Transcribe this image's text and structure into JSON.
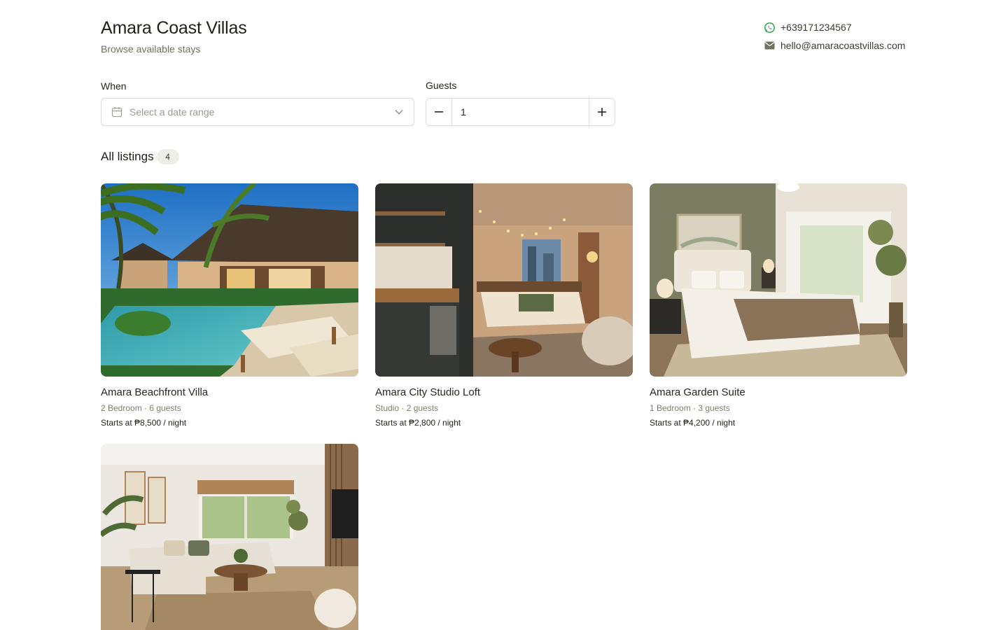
{
  "header": {
    "title": "Amara Coast Villas",
    "subtitle": "Browse available stays"
  },
  "contact": {
    "phone": "+639171234567",
    "phone_icon": "whatsapp-icon",
    "email": "hello@amaracoastvillas.com",
    "email_icon": "mail-icon"
  },
  "filters": {
    "when_label": "When",
    "date_placeholder": "Select a date range",
    "guests_label": "Guests",
    "guests_value": "1"
  },
  "listings": {
    "heading": "All listings",
    "count": "4",
    "items": [
      {
        "name": "Amara Beachfront Villa",
        "meta": "2 Bedroom · 6 guests",
        "price": "Starts at ₱8,500 / night",
        "image": "villa-pool-photo"
      },
      {
        "name": "Amara City Studio Loft",
        "meta": "Studio · 2 guests",
        "price": "Starts at ₱2,800 / night",
        "image": "studio-loft-photo"
      },
      {
        "name": "Amara Garden Suite",
        "meta": "1 Bedroom · 3 guests",
        "price": "Starts at ₱4,200 / night",
        "image": "garden-suite-photo"
      },
      {
        "name": "",
        "meta": "",
        "price": "",
        "image": "living-room-photo"
      }
    ]
  },
  "colors": {
    "accent_green": "#25a244",
    "muted_text": "#6e7160",
    "border": "#dcdcd6"
  }
}
